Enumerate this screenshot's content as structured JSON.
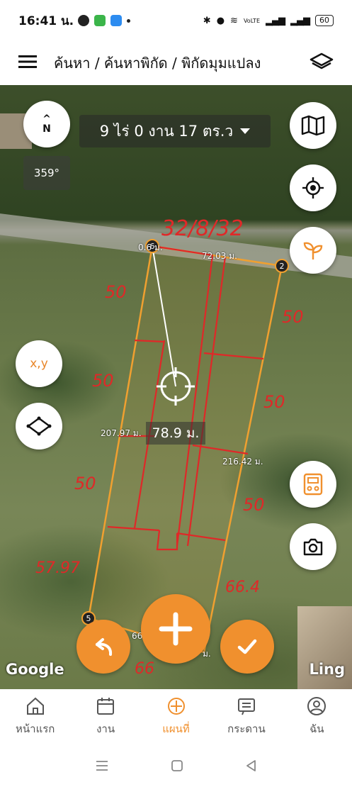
{
  "status_bar": {
    "time": "16:41 น.",
    "carrier": "VoLTE",
    "battery": "60"
  },
  "app_bar": {
    "title": "ค้นหา / ค้นหาพิกัด / พิกัดมุมแปลง"
  },
  "map": {
    "area_label": "9 ไร่ 0 งาน 17 ตร.ว",
    "heading": "359°",
    "compass_letter": "N",
    "xy_label": "x,y",
    "measurements": {
      "top_left": "0.6 ม.",
      "top": "72.03 ม.",
      "left": "207.97 ม.",
      "center": "78.9 ม.",
      "right": "216.42 ม.",
      "bottom": "66",
      "bottom_right": "ม."
    },
    "vertices": [
      "6",
      "2",
      "5"
    ],
    "handwritten": [
      "32/8/32",
      "50",
      "50",
      "50",
      "50",
      "50",
      "50",
      "57.97",
      "66.4",
      "66"
    ],
    "google_label": "Google",
    "ling_label": "Ling"
  },
  "bottom_nav": {
    "items": [
      {
        "label": "หน้าแรก",
        "icon": "home-icon"
      },
      {
        "label": "งาน",
        "icon": "calendar-icon"
      },
      {
        "label": "แผนที่",
        "icon": "map-plus-icon",
        "active": true
      },
      {
        "label": "กระดาน",
        "icon": "board-icon"
      },
      {
        "label": "ฉัน",
        "icon": "profile-icon"
      }
    ]
  },
  "colors": {
    "accent": "#f0902e",
    "plot_outline": "#f0a030",
    "annotation": "#e02828"
  }
}
